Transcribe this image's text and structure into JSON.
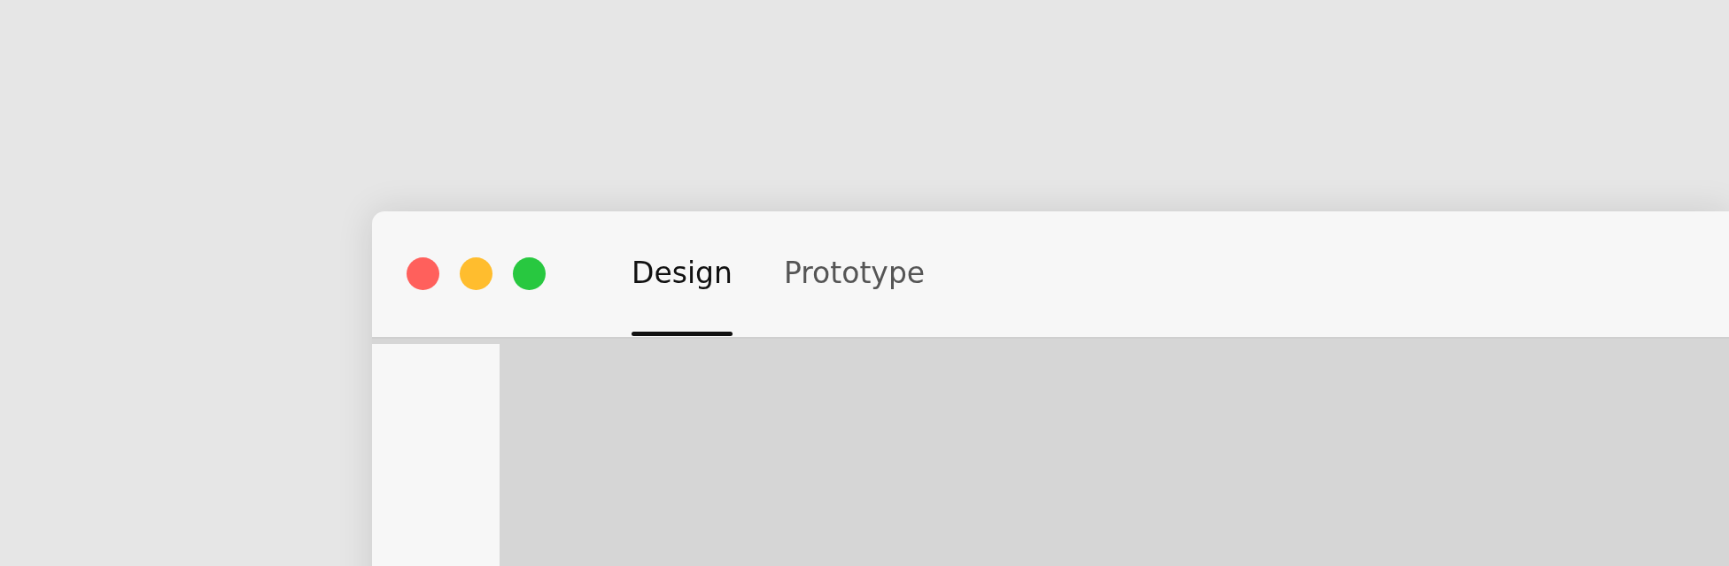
{
  "window_controls": [
    {
      "color": "#ff605c"
    },
    {
      "color": "#ffbd2e"
    },
    {
      "color": "#28c840"
    }
  ],
  "tabs": [
    {
      "label": "Design",
      "selected": true
    },
    {
      "label": "Prototype",
      "selected": false
    }
  ]
}
